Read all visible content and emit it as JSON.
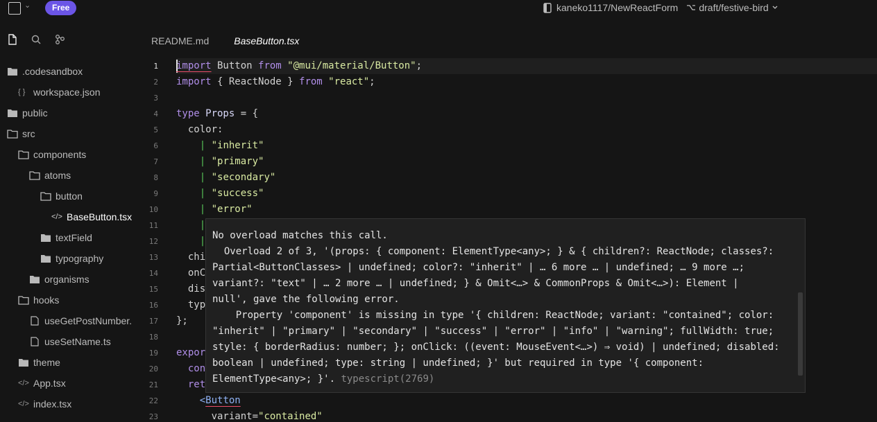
{
  "topbar": {
    "free_badge": "Free",
    "repo": "kaneko1117/NewReactForm",
    "branch": "draft/festive-bird"
  },
  "sidebar": {
    "icons": [
      "files-icon",
      "search-icon",
      "git-icon"
    ],
    "tree": [
      {
        "label": ".codesandbox",
        "type": "folder"
      },
      {
        "label": "workspace.json",
        "type": "json"
      },
      {
        "label": "public",
        "type": "folder"
      },
      {
        "label": "src",
        "type": "folder"
      },
      {
        "label": "components",
        "type": "folder"
      },
      {
        "label": "atoms",
        "type": "folder"
      },
      {
        "label": "button",
        "type": "folder"
      },
      {
        "label": "BaseButton.tsx",
        "type": "code",
        "active": true
      },
      {
        "label": "textField",
        "type": "folder"
      },
      {
        "label": "typography",
        "type": "folder"
      },
      {
        "label": "organisms",
        "type": "folder"
      },
      {
        "label": "hooks",
        "type": "folder"
      },
      {
        "label": "useGetPostNumber.",
        "type": "file"
      },
      {
        "label": "useSetName.ts",
        "type": "file"
      },
      {
        "label": "theme",
        "type": "folder"
      },
      {
        "label": "App.tsx",
        "type": "code"
      },
      {
        "label": "index.tsx",
        "type": "code"
      }
    ]
  },
  "tabs": [
    {
      "label": "README.md",
      "active": false
    },
    {
      "label": "BaseButton.tsx",
      "active": true
    }
  ],
  "editor": {
    "line_numbers": [
      "1",
      "2",
      "3",
      "4",
      "5",
      "6",
      "7",
      "8",
      "9",
      "10",
      "11",
      "12",
      "13",
      "14",
      "15",
      "16",
      "17",
      "18",
      "19",
      "20",
      "21",
      "22",
      "23"
    ],
    "code": {
      "l1_import": "import",
      "l1_button": " Button ",
      "l1_from": "from",
      "l1_str": " \"@mui/material/Button\"",
      "l1_semi": ";",
      "l2_import": "import",
      "l2_mid": " { ReactNode } ",
      "l2_from": "from",
      "l2_str": " \"react\"",
      "l2_semi": ";",
      "l4_type": "type",
      "l4_props": " Props",
      "l4_rest": " = {",
      "l5": "  color:",
      "l6_val": "\"inherit\"",
      "l7_val": "\"primary\"",
      "l8_val": "\"secondary\"",
      "l9_val": "\"success\"",
      "l10_val": "\"error\"",
      "l13": "  chi",
      "l14": "  onC",
      "l15": "  dis",
      "l16": "  typ",
      "l17": "};",
      "l19": "expor",
      "l20": "  con",
      "l21": "  ret",
      "l22_bracket": "    <",
      "l22_tag": "Button",
      "l23_attr": "      variant=",
      "l23_val": "\"contained\"",
      "pipe": "|"
    }
  },
  "tooltip": {
    "lines": [
      "No overload matches this call.",
      "  Overload 2 of 3, '(props: { component: ElementType<any>; } & { children?: ReactNode; classes?:",
      "Partial<ButtonClasses> | undefined; color?: \"inherit\" | … 6 more … | undefined; … 9 more …;",
      "variant?: \"text\" | … 2 more … | undefined; } & Omit<…> & CommonProps & Omit<…>): Element |",
      "null', gave the following error.",
      "    Property 'component' is missing in type '{ children: ReactNode; variant: \"contained\"; color:",
      "\"inherit\" | \"primary\" | \"secondary\" | \"success\" | \"error\" | \"info\" | \"warning\"; fullWidth: true;",
      "style: { borderRadius: number; }; onClick: ((event: MouseEvent<…>) ⇒ void) | undefined; disabled:",
      "boolean | undefined; type: string | undefined; }' but required in type '{ component:"
    ],
    "last_line": "ElementType<any>; }'.",
    "source": "typescript(2769)"
  }
}
